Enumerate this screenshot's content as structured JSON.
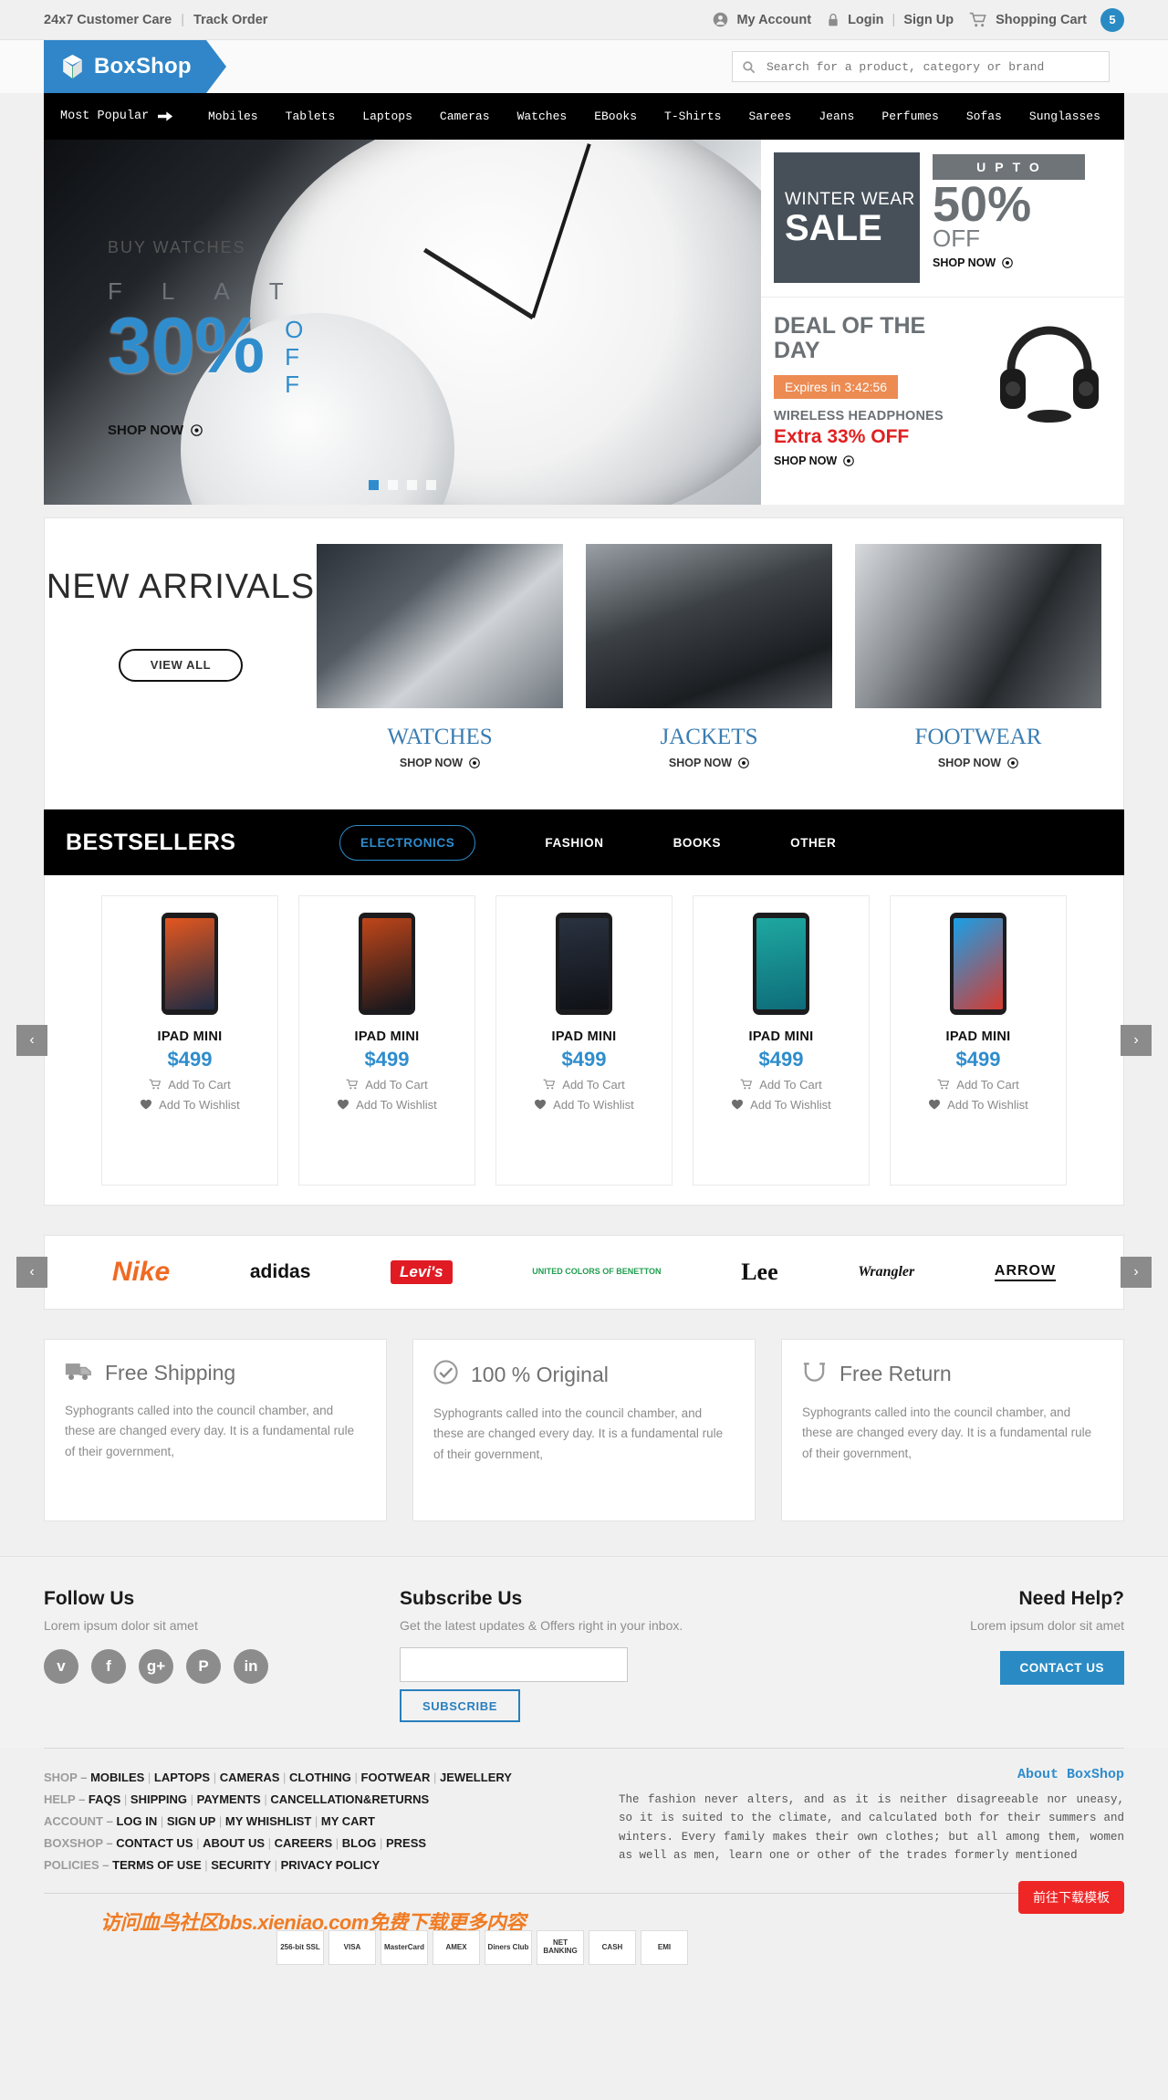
{
  "topbar": {
    "customer_care": "24x7 Customer Care",
    "separator": "|",
    "track_order": "Track Order",
    "my_account": "My Account",
    "login": "Login",
    "login_sep": "|",
    "signup": "Sign Up",
    "shopping_cart": "Shopping Cart",
    "cart_count": "5"
  },
  "header": {
    "logo_text": "BoxShop",
    "search_placeholder": "Search for a product, category or brand"
  },
  "nav": {
    "most_popular": "Most Popular",
    "items": [
      "Mobiles",
      "Tablets",
      "Laptops",
      "Cameras",
      "Watches",
      "EBooks",
      "T-Shirts",
      "Sarees",
      "Jeans",
      "Perfumes",
      "Sofas",
      "Sunglasses"
    ]
  },
  "hero": {
    "eyebrow": "BUY WATCHES",
    "flat_letters": [
      "F",
      "L",
      "A",
      "T"
    ],
    "percent": "30%",
    "off": [
      "O",
      "F",
      "F"
    ],
    "shop_now": "SHOP NOW",
    "slide_count": 4,
    "active_slide": 0
  },
  "winter": {
    "line1": "WINTER WEAR",
    "line2": "SALE",
    "upto": "UPTO",
    "percent": "50%",
    "off": "OFF",
    "shop_now": "SHOP NOW"
  },
  "deal": {
    "title": "DEAL OF THE DAY",
    "expires": "Expires in 3:42:56",
    "product": "WIRELESS HEADPHONES",
    "discount": "Extra 33% OFF",
    "shop_now": "SHOP NOW"
  },
  "arrivals": {
    "title": "NEW ARRIVALS",
    "view_all": "VIEW ALL",
    "cards": [
      {
        "category": "WATCHES",
        "shop_now": "SHOP NOW"
      },
      {
        "category": "JACKETS",
        "shop_now": "SHOP NOW"
      },
      {
        "category": "FOOTWEAR",
        "shop_now": "SHOP NOW"
      }
    ]
  },
  "bestsellers": {
    "title": "BESTSELLERS",
    "tabs": [
      {
        "label": "ELECTRONICS",
        "active": true
      },
      {
        "label": "FASHION",
        "active": false
      },
      {
        "label": "BOOKS",
        "active": false
      },
      {
        "label": "OTHER",
        "active": false
      }
    ],
    "products": [
      {
        "name": "IPAD MINI",
        "price": "$499",
        "cart": "Add To Cart",
        "wishlist": "Add To Wishlist"
      },
      {
        "name": "IPAD MINI",
        "price": "$499",
        "cart": "Add To Cart",
        "wishlist": "Add To Wishlist"
      },
      {
        "name": "IPAD MINI",
        "price": "$499",
        "cart": "Add To Cart",
        "wishlist": "Add To Wishlist"
      },
      {
        "name": "IPAD MINI",
        "price": "$499",
        "cart": "Add To Cart",
        "wishlist": "Add To Wishlist"
      },
      {
        "name": "IPAD MINI",
        "price": "$499",
        "cart": "Add To Cart",
        "wishlist": "Add To Wishlist"
      }
    ],
    "prev": "‹",
    "next": "›"
  },
  "brands": {
    "items": [
      "Nike",
      "adidas",
      "Levi's",
      "UNITED COLORS OF BENETTON",
      "Lee",
      "Wrangler",
      "ARROW"
    ],
    "prev": "‹",
    "next": "›"
  },
  "services": [
    {
      "icon": "truck-icon",
      "title": "Free Shipping",
      "text": "Syphogrants called into the council chamber, and these are changed every day. It is a fundamental rule of their government,"
    },
    {
      "icon": "check-circle-icon",
      "title": "100 % Original",
      "text": "Syphogrants called into the council chamber, and these are changed every day. It is a fundamental rule of their government,"
    },
    {
      "icon": "return-icon",
      "title": "Free Return",
      "text": "Syphogrants called into the council chamber, and these are changed every day. It is a fundamental rule of their government,"
    }
  ],
  "footer": {
    "follow_title": "Follow Us",
    "follow_sub": "Lorem ipsum dolor sit amet",
    "socials": [
      {
        "name": "twitter-icon",
        "glyph": "ᴠ"
      },
      {
        "name": "facebook-icon",
        "glyph": "f"
      },
      {
        "name": "google-plus-icon",
        "glyph": "g+"
      },
      {
        "name": "pinterest-icon",
        "glyph": "P"
      },
      {
        "name": "linkedin-icon",
        "glyph": "in"
      }
    ],
    "subscribe_title": "Subscribe Us",
    "subscribe_sub": "Get the latest updates & Offers right in your inbox.",
    "subscribe_value": "",
    "subscribe_placeholder": "",
    "subscribe_button": "SUBSCRIBE",
    "help_title": "Need Help?",
    "help_sub": "Lorem ipsum dolor sit amet",
    "contact_button": "CONTACT US",
    "link_groups": [
      {
        "category": "SHOP",
        "dash": "–",
        "items": [
          "MOBILES",
          "LAPTOPS",
          "CAMERAS",
          "CLOTHING",
          "FOOTWEAR",
          "JEWELLERY"
        ]
      },
      {
        "category": "HELP",
        "dash": "–",
        "items": [
          "FAQS",
          "SHIPPING",
          "PAYMENTS",
          "CANCELLATION&RETURNS"
        ]
      },
      {
        "category": "ACCOUNT",
        "dash": "–",
        "items": [
          "LOG IN",
          "SIGN UP",
          "MY WHISHLIST",
          "MY CART"
        ]
      },
      {
        "category": "BOXSHOP",
        "dash": "–",
        "items": [
          "CONTACT US",
          "ABOUT US",
          "CAREERS",
          "BLOG",
          "PRESS"
        ]
      },
      {
        "category": "POLICIES",
        "dash": "–",
        "items": [
          "TERMS OF USE",
          "SECURITY",
          "PRIVACY POLICY"
        ]
      }
    ],
    "about_title": "About BoxShop",
    "about_text": "The fashion never alters, and as it is neither disagreeable nor uneasy, so it is suited to the climate, and calculated both for their summers and winters. Every family makes their own clothes; but all among them, women as well as men, learn one or other of the trades formerly mentioned",
    "watermark": "访问血鸟社区bbs.xieniao.com免费下载更多内容",
    "download_button": "前往下载模板",
    "payments": [
      "256-bit SSL",
      "VISA",
      "MasterCard",
      "AMEX",
      "Diners Club",
      "NET BANKING",
      "CASH",
      "EMI"
    ]
  },
  "colors": {
    "brand_blue": "#3086c8",
    "accent_blue": "#2f8dcd",
    "orange": "#ec8b52",
    "red": "#e02020",
    "dark": "#000000"
  }
}
